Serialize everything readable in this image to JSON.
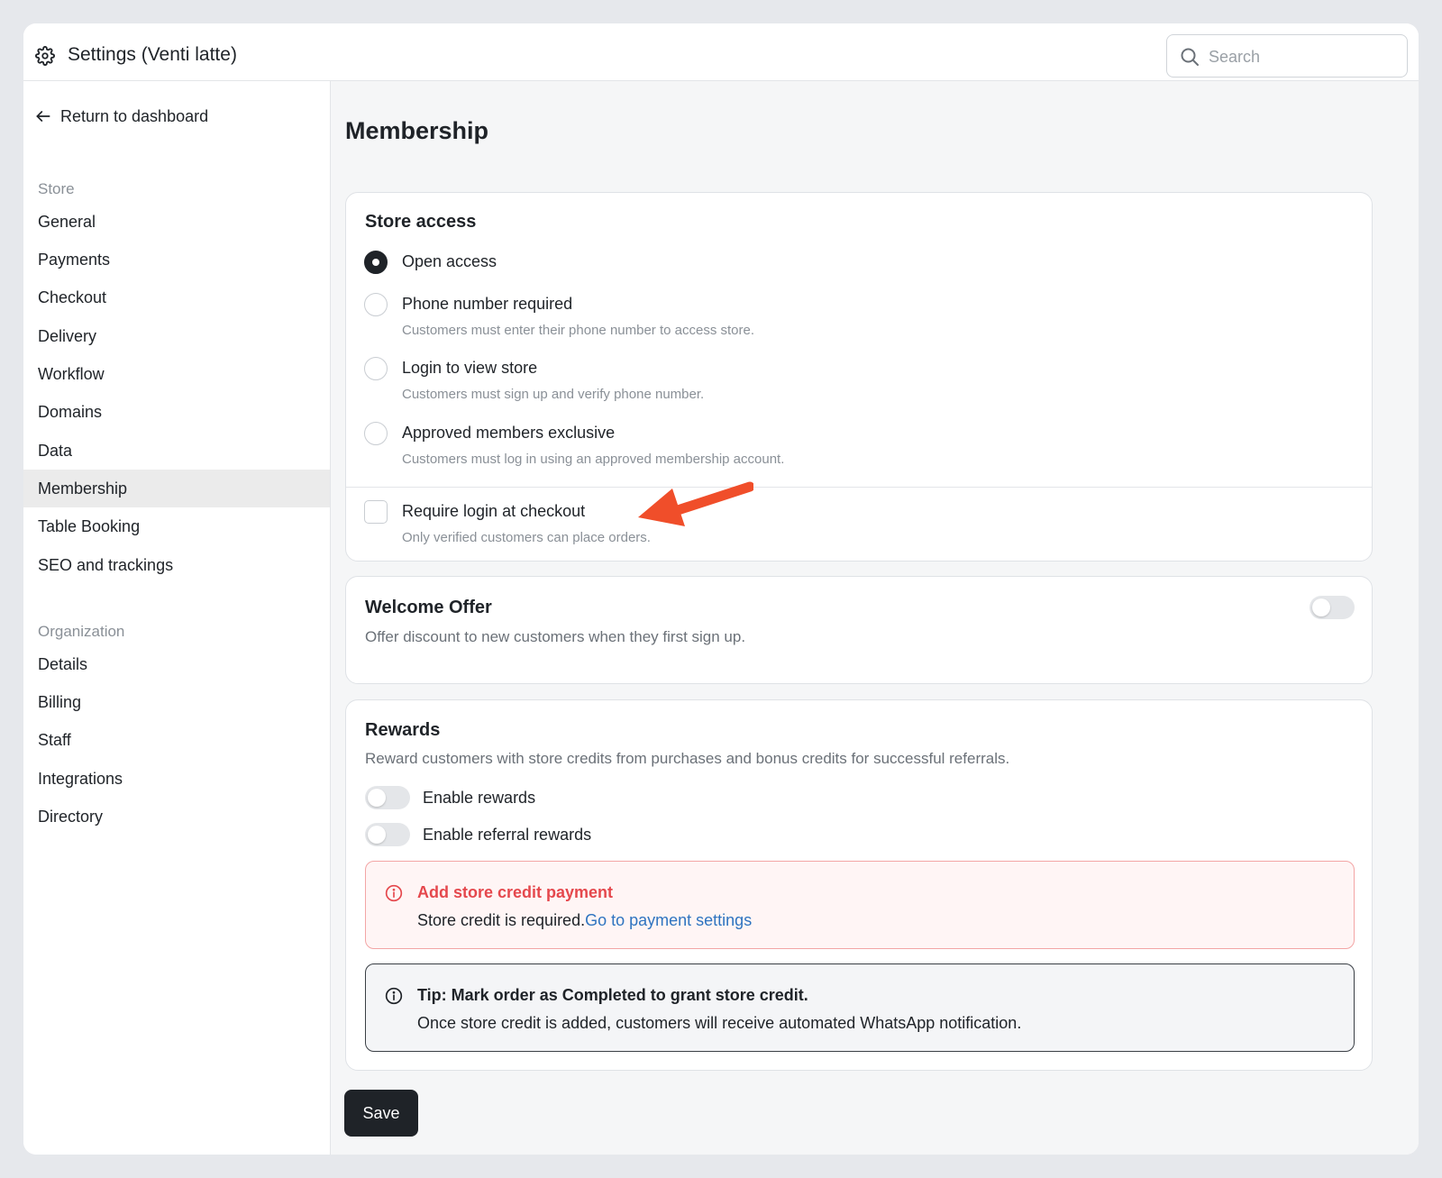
{
  "header": {
    "title": "Settings (Venti latte)",
    "search_placeholder": "Search"
  },
  "sidebar": {
    "back_label": "Return to dashboard",
    "store_section": "Store",
    "store_items": [
      "General",
      "Payments",
      "Checkout",
      "Delivery",
      "Workflow",
      "Domains",
      "Data",
      "Membership",
      "Table Booking",
      "SEO and trackings"
    ],
    "active_item": "Membership",
    "org_section": "Organization",
    "org_items": [
      "Details",
      "Billing",
      "Staff",
      "Integrations",
      "Directory"
    ]
  },
  "main": {
    "page_title": "Membership",
    "store_access": {
      "title": "Store access",
      "options": [
        {
          "label": "Open access",
          "hint": "",
          "checked": true
        },
        {
          "label": "Phone number required",
          "hint": "Customers must enter their phone number to access store.",
          "checked": false
        },
        {
          "label": "Login to view store",
          "hint": "Customers must sign up and verify phone number.",
          "checked": false
        },
        {
          "label": "Approved members exclusive",
          "hint": "Customers must log in using an approved membership account.",
          "checked": false
        }
      ],
      "checkout_login": {
        "label": "Require login at checkout",
        "hint": "Only verified customers can place orders.",
        "checked": false
      }
    },
    "welcome_offer": {
      "title": "Welcome Offer",
      "desc": "Offer discount to new customers when they first sign up.",
      "enabled": false
    },
    "rewards": {
      "title": "Rewards",
      "desc": "Reward customers with store credits from purchases and bonus credits for successful referrals.",
      "toggles": [
        {
          "label": "Enable rewards",
          "enabled": false
        },
        {
          "label": "Enable referral rewards",
          "enabled": false
        }
      ],
      "error_alert": {
        "title": "Add store credit payment",
        "body": "Store credit is required.",
        "link": "Go to payment settings"
      },
      "tip_alert": {
        "title": "Tip: Mark order as Completed to grant store credit.",
        "body": "Once store credit is added, customers will receive automated WhatsApp notification."
      }
    },
    "save_label": "Save"
  },
  "colors": {
    "accent_dark": "#1f2328",
    "error_red": "#e5484d",
    "link_blue": "#2f74c0",
    "annotation_arrow": "#f04e2a"
  }
}
